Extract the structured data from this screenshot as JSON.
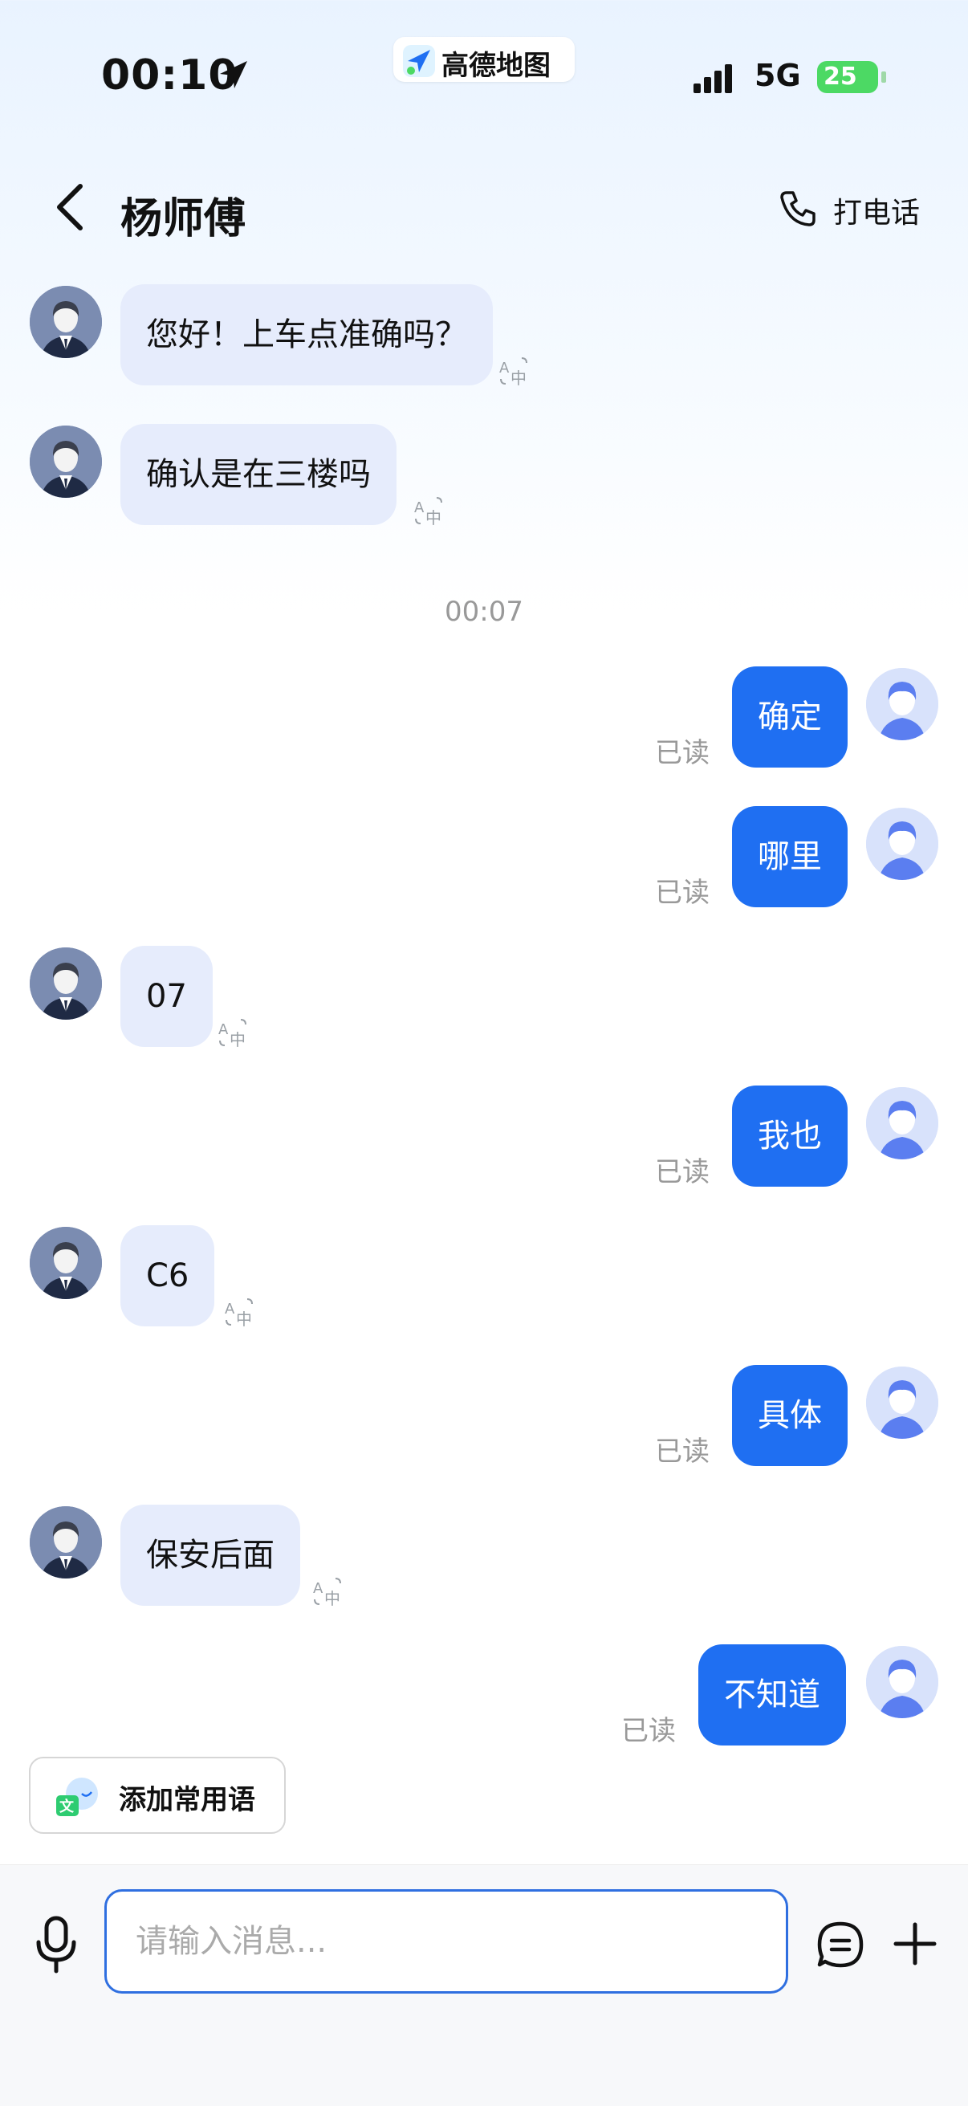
{
  "status_bar": {
    "time": "00:10",
    "app_name": "高德地图",
    "network": "5G",
    "battery": "25"
  },
  "header": {
    "title": "杨师傅",
    "call_label": "打电话"
  },
  "messages": [
    {
      "side": "in",
      "text": "您好！上车点准确吗？"
    },
    {
      "side": "in",
      "text": "确认是在三楼吗"
    },
    {
      "timestamp": "00:07"
    },
    {
      "side": "out",
      "text": "确定",
      "status": "已读"
    },
    {
      "side": "out",
      "text": "哪里",
      "status": "已读"
    },
    {
      "side": "in",
      "text": "07"
    },
    {
      "side": "out",
      "text": "我也",
      "status": "已读"
    },
    {
      "side": "in",
      "text": "C6"
    },
    {
      "side": "out",
      "text": "具体",
      "status": "已读"
    },
    {
      "side": "in",
      "text": "保安后面"
    },
    {
      "side": "out",
      "text": "不知道",
      "status": "已读"
    }
  ],
  "quick_phrase": {
    "label": "添加常用语"
  },
  "composer": {
    "placeholder": "请输入消息..."
  },
  "colors": {
    "outgoing_bubble": "#1f6ff2",
    "incoming_bubble": "#e6ecfc",
    "input_border": "#2f6fe0"
  },
  "icons": [
    "location-arrow-icon",
    "amap-logo-icon",
    "signal-icon",
    "battery-icon",
    "back-icon",
    "phone-icon",
    "driver-avatar",
    "user-avatar",
    "translate-icon",
    "quick-phrase-icon",
    "mic-icon",
    "quick-reply-icon",
    "plus-icon"
  ]
}
